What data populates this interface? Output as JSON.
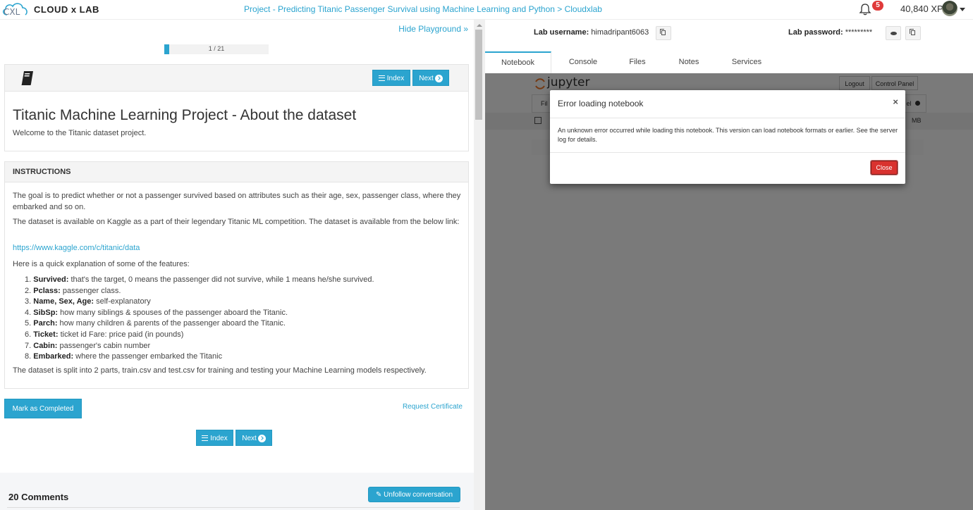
{
  "topbar": {
    "logo_text": "CLOUD x LAB",
    "page_title": "Project - Predicting Titanic Passenger Survival using Machine Learning and Python > Cloudxlab",
    "notification_count": "5",
    "xp": "40,840 XP",
    "icons": {
      "notifications": "bell-icon",
      "user_menu": "chevron-down-icon"
    }
  },
  "left": {
    "hide_playground": "Hide Playground »",
    "progress": {
      "label": "1 / 21",
      "current": 1,
      "total": 21
    },
    "nav": {
      "index_label": "Index",
      "next_label": "Next"
    },
    "lesson": {
      "title": "Titanic Machine Learning Project - About the dataset",
      "subtitle": "Welcome to the Titanic dataset project."
    },
    "instructions": {
      "heading": "INSTRUCTIONS",
      "para1": "The goal is to predict whether or not a passenger survived based on attributes such as their age, sex, passenger class, where they embarked and so on.",
      "para2": "The dataset is available on Kaggle as a part of their legendary Titanic ML competition. The dataset is available from the below link:",
      "link": "https://www.kaggle.com/c/titanic/data",
      "para3": "Here is a quick explanation of some of the features:",
      "features": [
        {
          "num": "1.",
          "name": "Survived:",
          "desc": " that's the target, 0 means the passenger did not survive, while 1 means he/she survived."
        },
        {
          "num": "2.",
          "name": "Pclass:",
          "desc": " passenger class."
        },
        {
          "num": "3.",
          "name": "Name, Sex, Age:",
          "desc": " self-explanatory"
        },
        {
          "num": "4.",
          "name": "SibSp:",
          "desc": " how many siblings & spouses of the passenger aboard the Titanic."
        },
        {
          "num": "5.",
          "name": "Parch:",
          "desc": " how many children & parents of the passenger aboard the Titanic."
        },
        {
          "num": "6.",
          "name": "Ticket:",
          "desc": " ticket id Fare: price paid (in pounds)"
        },
        {
          "num": "7.",
          "name": "Cabin:",
          "desc": " passenger's cabin number"
        },
        {
          "num": "8.",
          "name": "Embarked:",
          "desc": " where the passenger embarked the Titanic"
        }
      ],
      "para4": "The dataset is split into 2 parts, train.csv and test.csv for training and testing your Machine Learning models respectively."
    },
    "mark_completed": "Mark as Completed",
    "request_certificate": "Request Certificate",
    "comments": {
      "title": "20 Comments",
      "unfollow": "Unfollow conversation"
    }
  },
  "right": {
    "username_label": "Lab username:",
    "username": "himadripant6063",
    "password_label": "Lab password:",
    "password": "*********",
    "tabs": [
      {
        "label": "Notebook",
        "active": true
      },
      {
        "label": "Console",
        "active": false
      },
      {
        "label": "Files",
        "active": false
      },
      {
        "label": "Notes",
        "active": false
      },
      {
        "label": "Services",
        "active": false
      }
    ],
    "jupyter": {
      "logo": "jupyter",
      "logout": "Logout",
      "control_panel": "Control Panel",
      "menu_partial_left": "Fil",
      "menu_partial_right": "el",
      "memory_partial": "MB"
    },
    "modal": {
      "title": "Error loading notebook",
      "message": "An unknown error occurred while loading this notebook. This version can load notebook formats or earlier. See the server log for details.",
      "close_label": "Close",
      "close_x": "×"
    }
  },
  "colors": {
    "accent": "#2ba4cf",
    "danger": "#d9322f",
    "badge": "#e03a3a"
  }
}
